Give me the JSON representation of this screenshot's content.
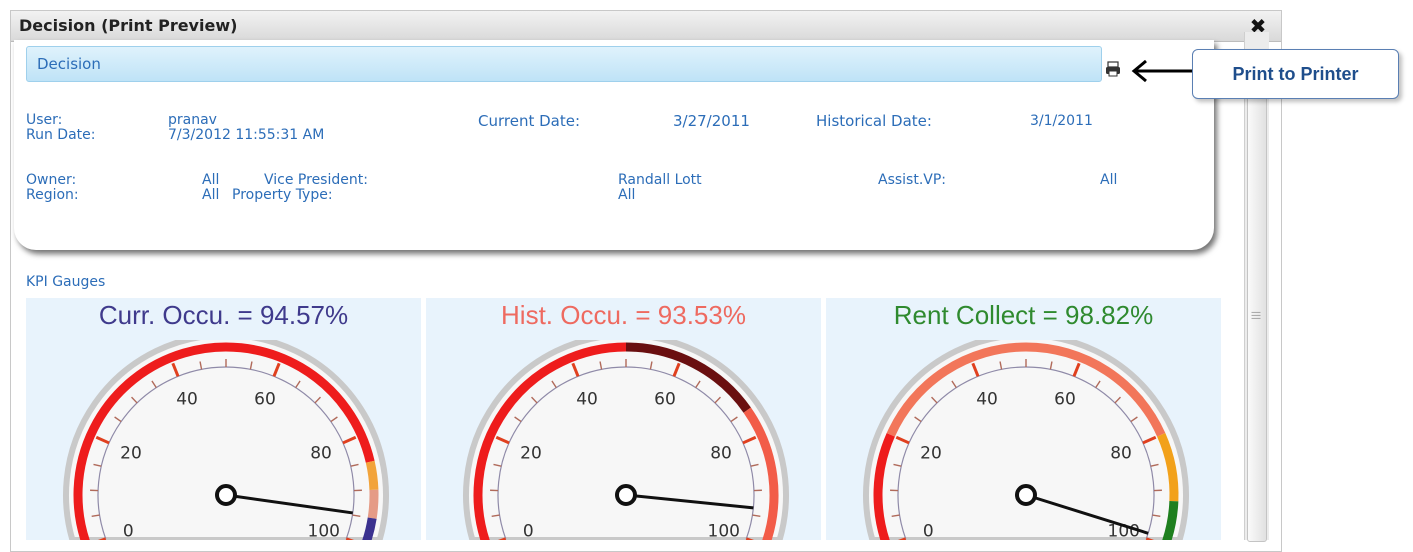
{
  "window": {
    "title": "Decision (Print Preview)",
    "close_symbol": "✖"
  },
  "section": {
    "label": "Decision"
  },
  "info": {
    "user_label": "User:",
    "user_value": "pranav",
    "run_date_label": "Run Date:",
    "run_date_value": "7/3/2012 11:55:31 AM",
    "current_date_label": "Current Date:",
    "current_date_value": "3/27/2011",
    "historical_date_label": "Historical Date:",
    "historical_date_value": "3/1/2011",
    "owner_label": "Owner:",
    "owner_value": "All",
    "region_label": "Region:",
    "region_value": "All",
    "vp_label": "Vice President:",
    "vp_value": "Randall Lott",
    "property_type_label": "Property Type:",
    "property_type_value": "All",
    "assist_vp_label": "Assist.VP:",
    "assist_vp_value": "All"
  },
  "kpi_label": "KPI Gauges",
  "gauges": [
    {
      "title": "Curr. Occu. = 94.57%",
      "title_color": "#3f3a8c",
      "value": 94.57,
      "ticks": [
        "0",
        "20",
        "40",
        "60",
        "80",
        "100"
      ],
      "bands": [
        {
          "from": 0,
          "to": 85,
          "color": "#ee1c1c"
        },
        {
          "from": 85,
          "to": 90,
          "color": "#f2a33a"
        },
        {
          "from": 90,
          "to": 95,
          "color": "#e59b86"
        },
        {
          "from": 95,
          "to": 100,
          "color": "#3b318f"
        }
      ]
    },
    {
      "title": "Hist. Occu. = 93.53%",
      "title_color": "#ee6a60",
      "value": 93.53,
      "ticks": [
        "0",
        "20",
        "40",
        "60",
        "80",
        "100"
      ],
      "bands": [
        {
          "from": 0,
          "to": 50,
          "color": "#ee1c1c"
        },
        {
          "from": 50,
          "to": 75,
          "color": "#6a0f10"
        },
        {
          "from": 75,
          "to": 100,
          "color": "#f25c48"
        }
      ]
    },
    {
      "title": "Rent Collect = 98.82%",
      "title_color": "#2f8a2f",
      "value": 98.82,
      "ticks": [
        "0",
        "20",
        "40",
        "60",
        "80",
        "100"
      ],
      "bands": [
        {
          "from": 0,
          "to": 20,
          "color": "#ee1c1c"
        },
        {
          "from": 20,
          "to": 80,
          "color": "#f2765a"
        },
        {
          "from": 80,
          "to": 92,
          "color": "#f2a11a"
        },
        {
          "from": 92,
          "to": 100,
          "color": "#1e7f1e"
        }
      ]
    }
  ],
  "callout": {
    "text": "Print to Printer"
  },
  "icons": {
    "close": "close-icon",
    "printer": "printer-icon",
    "arrow": "arrow-left-icon"
  }
}
